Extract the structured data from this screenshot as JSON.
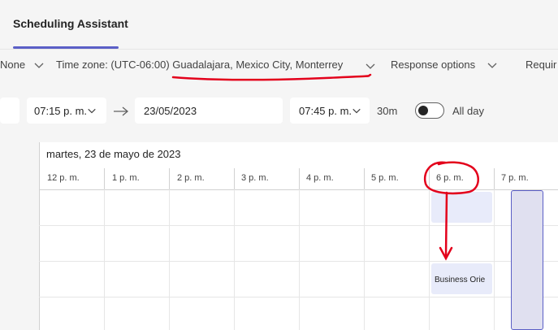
{
  "tabs": {
    "scheduling": "Scheduling Assistant"
  },
  "options": {
    "none_label": "None",
    "timezone_label": "Time zone: (UTC-06:00) Guadalajara, Mexico City, Monterrey",
    "response_label": "Response options",
    "required_label": "Requir"
  },
  "times": {
    "start_time": "07:15 p. m.",
    "end_date": "23/05/2023",
    "end_time": "07:45 p. m.",
    "duration": "30m",
    "all_day_label": "All day",
    "all_day_on": false
  },
  "calendar": {
    "date_heading": "martes, 23 de mayo de 2023",
    "hours": [
      "12 p. m.",
      "1 p. m.",
      "2 p. m.",
      "3 p. m.",
      "4 p. m.",
      "5 p. m.",
      "6 p. m.",
      "7 p. m."
    ],
    "event_label": "Business Orie"
  },
  "colors": {
    "accent": "#5b5fc7",
    "annotation": "#e3001b",
    "busy": "#e8ebfa"
  },
  "icons": [
    "chevron-down-icon",
    "arrow-right-icon"
  ]
}
